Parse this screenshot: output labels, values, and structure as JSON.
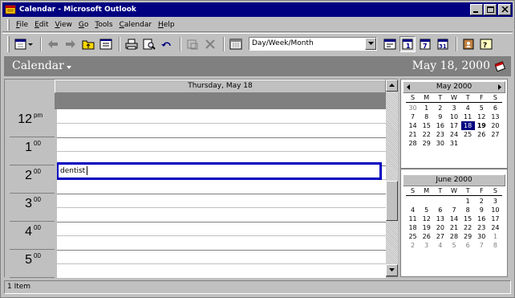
{
  "window": {
    "title": "Calendar - Microsoft Outlook"
  },
  "menu": {
    "items": [
      {
        "label": "File",
        "key": "F",
        "rest": "ile"
      },
      {
        "label": "Edit",
        "key": "E",
        "rest": "dit"
      },
      {
        "label": "View",
        "key": "V",
        "rest": "iew"
      },
      {
        "label": "Go",
        "key": "G",
        "rest": "o"
      },
      {
        "label": "Tools",
        "key": "T",
        "rest": "ools"
      },
      {
        "label": "Calendar",
        "key": "C",
        "rest": "alendar"
      },
      {
        "label": "Help",
        "key": "H",
        "rest": "elp"
      }
    ]
  },
  "toolbar": {
    "view_combo_value": "Day/Week/Month"
  },
  "banner": {
    "folder_name": "Calendar",
    "current_date": "May 18, 2000"
  },
  "dayview": {
    "header": "Thursday, May 18",
    "hours": [
      {
        "hour": "12",
        "suffix": "pm"
      },
      {
        "hour": "1",
        "suffix": "00"
      },
      {
        "hour": "2",
        "suffix": "00"
      },
      {
        "hour": "3",
        "suffix": "00"
      },
      {
        "hour": "4",
        "suffix": "00"
      },
      {
        "hour": "5",
        "suffix": "00"
      }
    ],
    "appointment": {
      "text": "dentist"
    }
  },
  "navigator": {
    "dow": [
      "S",
      "M",
      "T",
      "W",
      "T",
      "F",
      "S"
    ],
    "months": [
      {
        "title": "May 2000",
        "days": [
          {
            "d": "30",
            "cls": "other"
          },
          {
            "d": "1"
          },
          {
            "d": "2"
          },
          {
            "d": "3"
          },
          {
            "d": "4"
          },
          {
            "d": "5"
          },
          {
            "d": "6"
          },
          {
            "d": "7"
          },
          {
            "d": "8"
          },
          {
            "d": "9"
          },
          {
            "d": "10"
          },
          {
            "d": "11"
          },
          {
            "d": "12"
          },
          {
            "d": "13"
          },
          {
            "d": "14"
          },
          {
            "d": "15"
          },
          {
            "d": "16"
          },
          {
            "d": "17"
          },
          {
            "d": "18",
            "cls": "sel"
          },
          {
            "d": "19",
            "cls": "today"
          },
          {
            "d": "20"
          },
          {
            "d": "21"
          },
          {
            "d": "22"
          },
          {
            "d": "23"
          },
          {
            "d": "24"
          },
          {
            "d": "25"
          },
          {
            "d": "26"
          },
          {
            "d": "27"
          },
          {
            "d": "28"
          },
          {
            "d": "29"
          },
          {
            "d": "30"
          },
          {
            "d": "31"
          },
          {
            "d": ""
          },
          {
            "d": ""
          },
          {
            "d": ""
          }
        ]
      },
      {
        "title": "June 2000",
        "days": [
          {
            "d": ""
          },
          {
            "d": ""
          },
          {
            "d": ""
          },
          {
            "d": ""
          },
          {
            "d": "1"
          },
          {
            "d": "2"
          },
          {
            "d": "3"
          },
          {
            "d": "4"
          },
          {
            "d": "5"
          },
          {
            "d": "6"
          },
          {
            "d": "7"
          },
          {
            "d": "8"
          },
          {
            "d": "9"
          },
          {
            "d": "10"
          },
          {
            "d": "11"
          },
          {
            "d": "12"
          },
          {
            "d": "13"
          },
          {
            "d": "14"
          },
          {
            "d": "15"
          },
          {
            "d": "16"
          },
          {
            "d": "17"
          },
          {
            "d": "18"
          },
          {
            "d": "19"
          },
          {
            "d": "20"
          },
          {
            "d": "21"
          },
          {
            "d": "22"
          },
          {
            "d": "23"
          },
          {
            "d": "24"
          },
          {
            "d": "25"
          },
          {
            "d": "26"
          },
          {
            "d": "27"
          },
          {
            "d": "28"
          },
          {
            "d": "29"
          },
          {
            "d": "30"
          },
          {
            "d": "1",
            "cls": "other"
          },
          {
            "d": "2",
            "cls": "other"
          },
          {
            "d": "3",
            "cls": "other"
          },
          {
            "d": "4",
            "cls": "other"
          },
          {
            "d": "5",
            "cls": "other"
          },
          {
            "d": "6",
            "cls": "other"
          },
          {
            "d": "7",
            "cls": "other"
          },
          {
            "d": "8",
            "cls": "other"
          }
        ]
      }
    ]
  },
  "status": {
    "text": "1 Item"
  }
}
